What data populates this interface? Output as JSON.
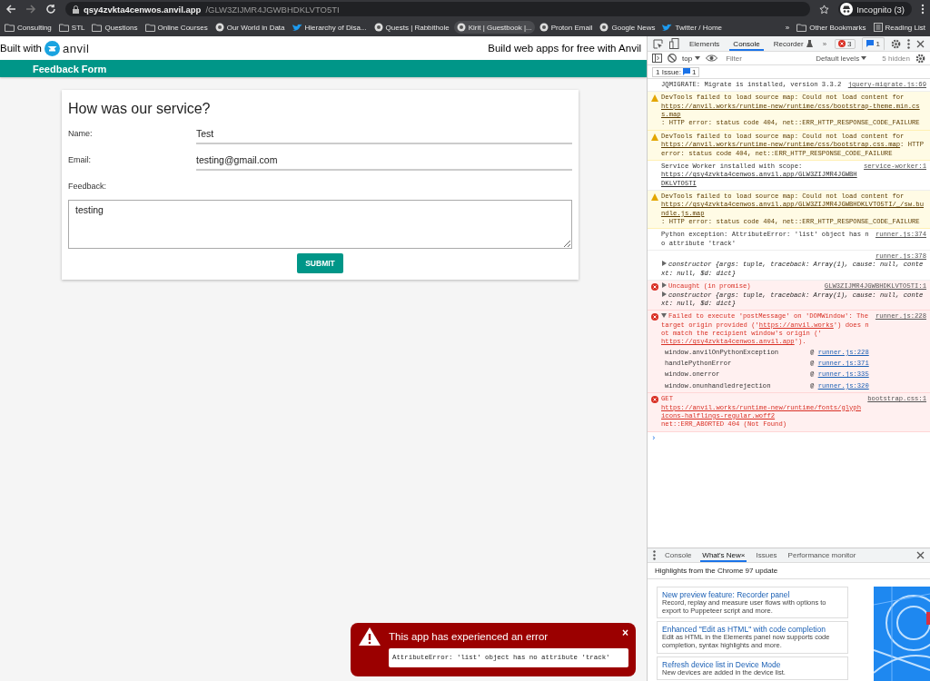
{
  "browser": {
    "url_host": "qsy4zvkta4cenwos.anvil.app",
    "url_path": "/GLW3ZIJMR4JGWBHDKLVTO5TI",
    "profile": "Incognito (3)",
    "bookmarks": [
      {
        "label": "Consulting",
        "kind": "folder",
        "selected": false
      },
      {
        "label": "STL",
        "kind": "folder",
        "selected": false
      },
      {
        "label": "Questions",
        "kind": "folder",
        "selected": false
      },
      {
        "label": "Online Courses",
        "kind": "folder",
        "selected": false
      },
      {
        "label": "Our World in Data",
        "kind": "site",
        "selected": false
      },
      {
        "label": "Hierarchy of Disa...",
        "kind": "bird",
        "selected": false
      },
      {
        "label": "Quests | Rabbithole",
        "kind": "site",
        "selected": false
      },
      {
        "label": "Kirit | Guestbook |...",
        "kind": "site",
        "selected": true
      },
      {
        "label": "Proton Email",
        "kind": "site",
        "selected": false
      },
      {
        "label": "Google News",
        "kind": "site",
        "selected": false
      },
      {
        "label": "Twitter / Home",
        "kind": "bird",
        "selected": false
      }
    ],
    "more": "»",
    "other_bookmarks": "Other Bookmarks",
    "reading_list": "Reading List"
  },
  "page": {
    "built_with": "Built with",
    "logo_text": "anvil",
    "promo": "Build web apps for free with Anvil",
    "header": "Feedback Form",
    "form": {
      "title": "How was our service?",
      "fields": [
        {
          "label": "Name:",
          "value": "Test",
          "kind": "line"
        },
        {
          "label": "Email:",
          "value": "testing@gmail.com",
          "kind": "line"
        },
        {
          "label": "Feedback:",
          "value": "testing",
          "kind": "area"
        }
      ],
      "submit": "SUBMIT"
    },
    "error_toast": {
      "title": "This app has experienced an error",
      "close": "×",
      "message": "AttributeError: 'list' object has no attribute 'track'"
    }
  },
  "devtools": {
    "tabs": [
      {
        "label": "Elements",
        "selected": false
      },
      {
        "label": "Console",
        "selected": true
      },
      {
        "label": "Recorder",
        "selected": false
      }
    ],
    "more": "»",
    "error_count": "3",
    "message_count": "1",
    "context": "top",
    "filter": {
      "placeholder": "Filter"
    },
    "levels": "Default levels",
    "hidden": "5 hidden",
    "issues": {
      "label": "1 Issue:",
      "count": "1"
    },
    "messages": [
      {
        "kind": "info",
        "source": "jquery-migrate.js:69",
        "parts": [
          {
            "kind": "plain",
            "text": "JQMIGRATE: Migrate is installed, version 3.3.2"
          }
        ]
      },
      {
        "kind": "warning",
        "parts": [
          {
            "kind": "plain",
            "text": "DevTools failed to load source map: Could not load content for "
          },
          {
            "kind": "link",
            "text": "https://anvil.works/runtime-new/runtime/css/bootstrap-theme.min.css.map"
          },
          {
            "kind": "plain",
            "text": ": HTTP error: status code 404, net::ERR_HTTP_RESPONSE_CODE_FAILURE"
          }
        ]
      },
      {
        "kind": "warning",
        "parts": [
          {
            "kind": "plain",
            "text": "DevTools failed to load source map: Could not load content for "
          },
          {
            "kind": "link",
            "text": "https://anvil.works/runtime-new/runtime/css/bootstrap.css.map"
          },
          {
            "kind": "plain",
            "text": ": HTTP error: status code 404, net::ERR_HTTP_RESPONSE_CODE_FAILURE"
          }
        ]
      },
      {
        "kind": "info",
        "source": "service-worker:1",
        "parts": [
          {
            "kind": "plain",
            "text": "Service Worker installed with scope: "
          },
          {
            "kind": "link",
            "text": "https://qsy4zvkta4cenwos.anvil.app/GLW3ZIJMR4JGWBHDKLVTO5TI"
          }
        ]
      },
      {
        "kind": "warning",
        "parts": [
          {
            "kind": "plain",
            "text": "DevTools failed to load source map: Could not load content for "
          },
          {
            "kind": "link",
            "text": "https://qsy4zvkta4cenwos.anvil.app/GLW3ZIJMR4JGWBHDKLVTO5TI/_/sw.bundle.js.map"
          },
          {
            "kind": "plain",
            "text": ": HTTP error: status code 404, net::ERR_HTTP_RESPONSE_CODE_FAILURE"
          }
        ]
      },
      {
        "kind": "info",
        "source": "runner.js:374",
        "parts": [
          {
            "kind": "plain",
            "text": "Python exception: AttributeError: 'list' object has no attribute 'track'"
          }
        ]
      },
      {
        "kind": "info",
        "source": "runner.js:378",
        "object": {
          "text": "constructor {args: tuple, traceback: Array(1), cause: null, context: null, $d: dict}",
          "expanded": false
        }
      },
      {
        "kind": "error",
        "source": "GLW3ZIJMR4JGWBHDKLVTO5TI:1",
        "expanded": false,
        "parts": [
          {
            "kind": "plain",
            "text": "Uncaught (in promise)"
          }
        ],
        "object": {
          "text": "constructor {args: tuple, traceback: Array(1), cause: null, context: null, $d: dict}",
          "expanded": false
        }
      },
      {
        "kind": "error",
        "source": "runner.js:228",
        "expanded": true,
        "parts": [
          {
            "kind": "plain",
            "text": "Failed to execute 'postMessage' on 'DOMWindow': The target origin provided ('"
          },
          {
            "kind": "link",
            "text": "https://anvil.works"
          },
          {
            "kind": "plain",
            "text": "') does not match the recipient window's origin ('"
          },
          {
            "kind": "link",
            "text": "https://qsy4zvkta4cenwos.anvil.app"
          },
          {
            "kind": "plain",
            "text": "')."
          }
        ],
        "stack": [
          {
            "function": "window.anvilOnPythonException",
            "at": "@",
            "link": "runner.js:228"
          },
          {
            "function": "handlePythonError",
            "at": "@",
            "link": "runner.js:371"
          },
          {
            "function": "window.onerror",
            "at": "@",
            "link": "runner.js:335"
          },
          {
            "function": "window.onunhandledrejection",
            "at": "@",
            "link": "runner.js:320"
          }
        ]
      },
      {
        "kind": "error",
        "source": "bootstrap.css:1",
        "parts": [
          {
            "kind": "plain",
            "text": "GET "
          },
          {
            "kind": "link",
            "text": "https://anvil.works/runtime-new/runtime/fonts/glyphicons-halflings-regular.woff2"
          },
          {
            "kind": "plain",
            "text": " net::ERR_ABORTED 404 (Not Found)"
          }
        ]
      }
    ],
    "prompt": "›",
    "drawer": {
      "tabs": [
        {
          "label": "Console",
          "selected": false,
          "closable": false
        },
        {
          "label": "What's New",
          "selected": true,
          "closable": true
        },
        {
          "label": "Issues",
          "selected": false,
          "closable": false
        },
        {
          "label": "Performance monitor",
          "selected": false,
          "closable": false
        }
      ],
      "close_tab": "×",
      "heading": "Highlights from the Chrome 97 update",
      "cards": [
        {
          "title": "New preview feature: Recorder panel",
          "text": "Record, replay and measure user flows with options to export to Puppeteer script and more."
        },
        {
          "title": "Enhanced \"Edit as HTML\" with code completion",
          "text": "Edit as HTML in the Elements panel now supports code completion, syntax highlights and more."
        },
        {
          "title": "Refresh device list in Device Mode",
          "text": "New devices are added in the device list."
        }
      ]
    }
  }
}
